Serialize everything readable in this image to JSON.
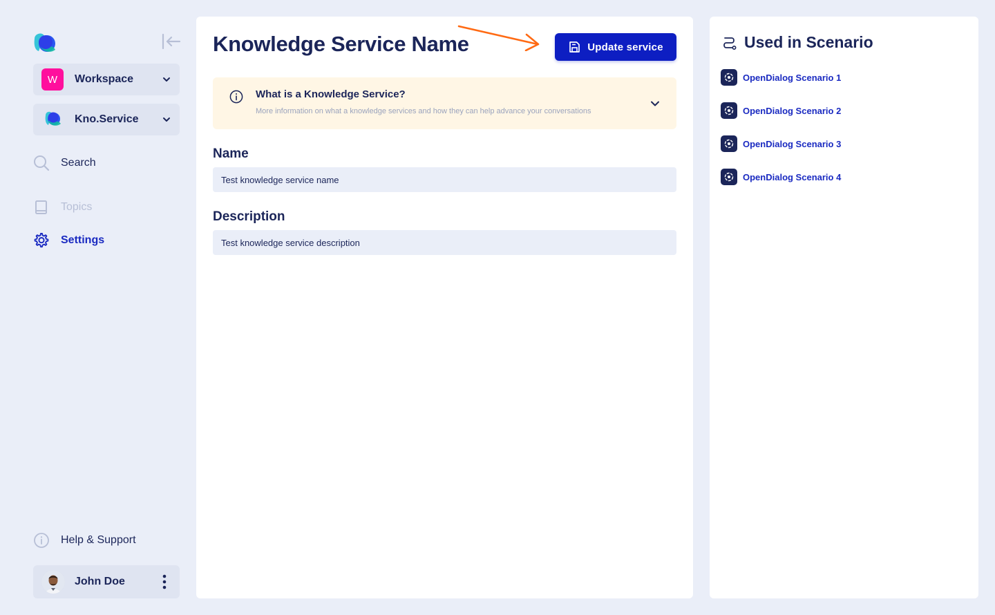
{
  "sidebar": {
    "workspace": {
      "badge": "W",
      "label": "Workspace"
    },
    "service": {
      "label": "Kno.Service"
    },
    "nav": {
      "search": "Search",
      "topics": "Topics",
      "settings": "Settings",
      "help": "Help & Support"
    },
    "user": {
      "name": "John Doe"
    }
  },
  "main": {
    "title": "Knowledge Service Name",
    "update_button": "Update service",
    "info": {
      "title": "What is a Knowledge Service?",
      "subtitle": "More information on what a knowledge services and how they can help advance your conversations"
    },
    "name_label": "Name",
    "name_value": "Test knowledge service name",
    "description_label": "Description",
    "description_value": "Test knowledge service description"
  },
  "right": {
    "title": "Used in Scenario",
    "scenarios": [
      "OpenDialog Scenario 1",
      "OpenDialog Scenario 2",
      "OpenDialog Scenario 3",
      "OpenDialog Scenario 4"
    ]
  },
  "colors": {
    "primary": "#0d1ec2",
    "link": "#1a2ac1",
    "text": "#1b2559",
    "background": "#eaeef8",
    "info_bg": "#fff6e5",
    "annotation_arrow": "#ff6a13",
    "workspace_badge": "#ff0f9d"
  },
  "icons": {
    "logo": "opendialog-logo-icon",
    "collapse": "collapse-left-icon",
    "search": "search-icon",
    "topics": "book-icon",
    "settings": "gear-icon",
    "help": "info-icon",
    "save": "save-icon",
    "route": "route-icon",
    "scenario": "scenario-icon"
  }
}
